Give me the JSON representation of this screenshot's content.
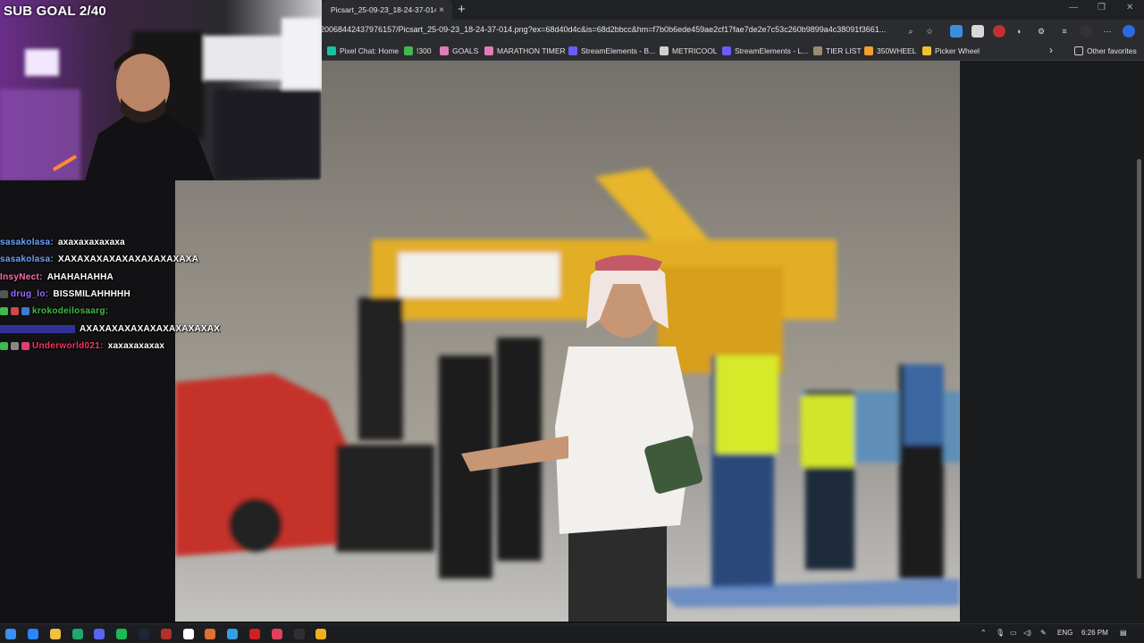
{
  "overlay": {
    "sub_goal": "SUB GOAL 2/40"
  },
  "browser": {
    "tab_title": "Picsart_25-09-23_18-24-37-014.p",
    "tab_close": "×",
    "new_tab": "+",
    "url": "20068442437976157/Picsart_25-09-23_18-24-37-014.png?ex=68d40d4c&is=68d2bbcc&hm=f7b0b6ede459ae2cf17fae7de2e7c53c260b9899a4c38091f3661...",
    "window_controls": [
      "—",
      "❐",
      "✕"
    ]
  },
  "bookmarks": [
    {
      "label": "Pixel Chat: Home",
      "color": "#19c2a0"
    },
    {
      "label": "!300",
      "color": "#3fb950"
    },
    {
      "label": "GOALS",
      "color": "#e07cb5"
    },
    {
      "label": "MARATHON TIMER",
      "color": "#e07cb5"
    },
    {
      "label": "StreamElements - B...",
      "color": "#6a5cff"
    },
    {
      "label": "METRICOOL",
      "color": "#cfcfcf"
    },
    {
      "label": "StreamElements - L...",
      "color": "#6a5cff"
    },
    {
      "label": "TIER LIST",
      "color": "#9b8b70"
    },
    {
      "label": "350WHEEL",
      "color": "#f0a030"
    },
    {
      "label": "Picker Wheel",
      "color": "#f0c030"
    }
  ],
  "bookmarks_overflow": "›",
  "other_favorites": "Other favorites",
  "chat": [
    {
      "user": "sasakolasa:",
      "user_color": "#6aa6ff",
      "message": "axaxaxaxaxaxa",
      "badges": []
    },
    {
      "user": "sasakolasa:",
      "user_color": "#6aa6ff",
      "message": "XAXAXAXAXAXAXAXAXAXAXA",
      "badges": []
    },
    {
      "user": "InsyNect:",
      "user_color": "#ff69b4",
      "message": "AHAHAHAHHA",
      "badges": []
    },
    {
      "user": "drug_lo:",
      "user_color": "#9b6bff",
      "message": "BISSMILAHHHHH",
      "badges": [
        "#555555"
      ]
    },
    {
      "user": "krokodeilosaarg:",
      "user_color": "#3fbf3f",
      "message": "",
      "badges": [
        "#3fb950",
        "#d04848",
        "#3a7bd5"
      ]
    },
    {
      "user": "",
      "user_color": "#4a4aff",
      "message": "AXAXAXAXAXAXAXAXAXAXAX",
      "badges": []
    },
    {
      "user": "Underworld021:",
      "user_color": "#ff3060",
      "message": "xaxaxaxaxax",
      "badges": [
        "#3fb950",
        "#888888",
        "#e04070"
      ]
    }
  ],
  "tray": {
    "language": "ENG",
    "time": "6:26 PM"
  },
  "taskbar_icons": [
    "#2a86ff",
    "#f0c040",
    "#1fa86a",
    "#5865f2",
    "#1db954",
    "#1b2838",
    "#b0302a",
    "#ffffff",
    "#e07030",
    "#30a0e0",
    "#d02020",
    "#e04060",
    "#303030",
    "#f0b020"
  ],
  "colors": {
    "chrome_bg": "#202124",
    "toolbar_bg": "#2b2c30"
  }
}
